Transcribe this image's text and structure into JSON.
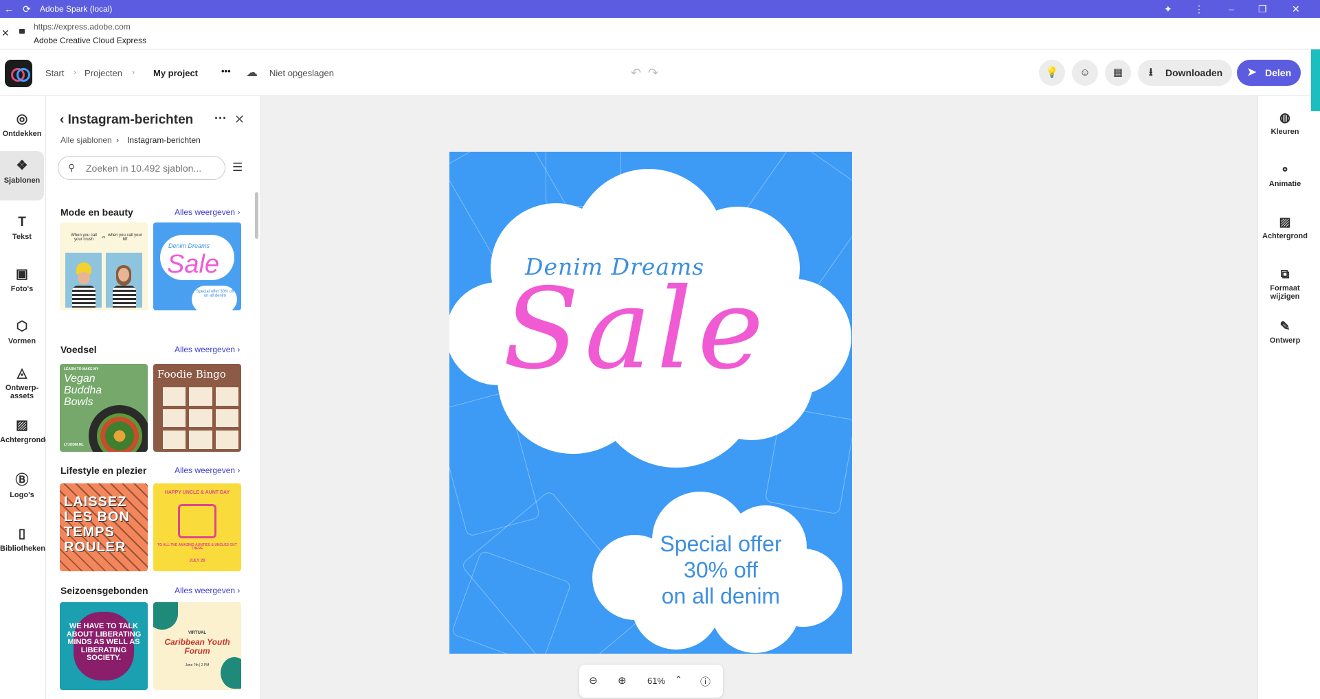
{
  "window": {
    "title": "Adobe Spark (local)"
  },
  "address": {
    "url": "https://express.adobe.com",
    "app_name": "Adobe Creative Cloud Express"
  },
  "header": {
    "breadcrumbs": [
      "Start",
      "Projecten",
      "My project"
    ],
    "more": "•••",
    "save_status": "Niet opgeslagen",
    "download_label": "Downloaden",
    "share_label": "Delen"
  },
  "left_rail": [
    {
      "label": "Ontdekken"
    },
    {
      "label": "Sjablonen",
      "active": true
    },
    {
      "label": "Tekst"
    },
    {
      "label": "Foto's"
    },
    {
      "label": "Vormen"
    },
    {
      "label": "Ontwerp-assets"
    },
    {
      "label": "Achtergronden"
    },
    {
      "label": "Logo's"
    },
    {
      "label": "Bibliotheken"
    }
  ],
  "panel": {
    "title": "Instagram-berichten",
    "crumb_parent": "Alle sjablonen",
    "crumb_current": "Instagram-berichten",
    "search_placeholder": "Zoeken in 10.492 sjablon...",
    "sections": [
      {
        "title": "Mode en beauty",
        "more": "Alles weergeven",
        "t1": {
          "a": "When you call your crush",
          "vs": "vs",
          "b": "when you call your bff"
        },
        "t2": {
          "script": "Denim Dreams",
          "big": "Sale",
          "offer": "Special offer 30% off on all denim"
        }
      },
      {
        "title": "Voedsel",
        "more": "Alles weergeven",
        "t1": {
          "top": "LEARN TO MAKE MY",
          "script": "Vegan Buddha Bowls",
          "foot": "LTJODM.ML"
        },
        "t2": {
          "title": "Foodie Bingo"
        }
      },
      {
        "title": "Lifestyle en plezier",
        "more": "Alles weergeven",
        "t1": {
          "big": "LAISSEZ LES BON TEMPS ROULER"
        },
        "t2": {
          "arc": "HAPPY UNCLE & AUNT DAY",
          "sub": "TO ALL THE AMAZING AUNTIES & UNCLES OUT THERE",
          "date": "JULY 26"
        }
      },
      {
        "title": "Seizoensgebonden",
        "more": "Alles weergeven",
        "t1": {
          "big": "WE HAVE TO TALK ABOUT LIBERATING MINDS AS WELL AS LIBERATING SOCIETY."
        },
        "t2": {
          "kicker": "VIRTUAL",
          "script": "Caribbean Youth Forum",
          "date": "June 7th | 2 PM"
        }
      }
    ]
  },
  "design": {
    "script_title": "Denim Dreams",
    "big_word": "Sale",
    "offer_lines": [
      "Special offer",
      "30% off",
      "on all denim"
    ],
    "colors": {
      "bg": "#3d9bf6",
      "sale": "#f05bd4",
      "script": "#3d8fe0"
    }
  },
  "zoom": {
    "value": "61%"
  },
  "right_rail": [
    {
      "label": "Kleuren"
    },
    {
      "label": "Animatie"
    },
    {
      "label": "Achtergrond"
    },
    {
      "label": "Formaat wijzigen"
    },
    {
      "label": "Ontwerp"
    }
  ]
}
